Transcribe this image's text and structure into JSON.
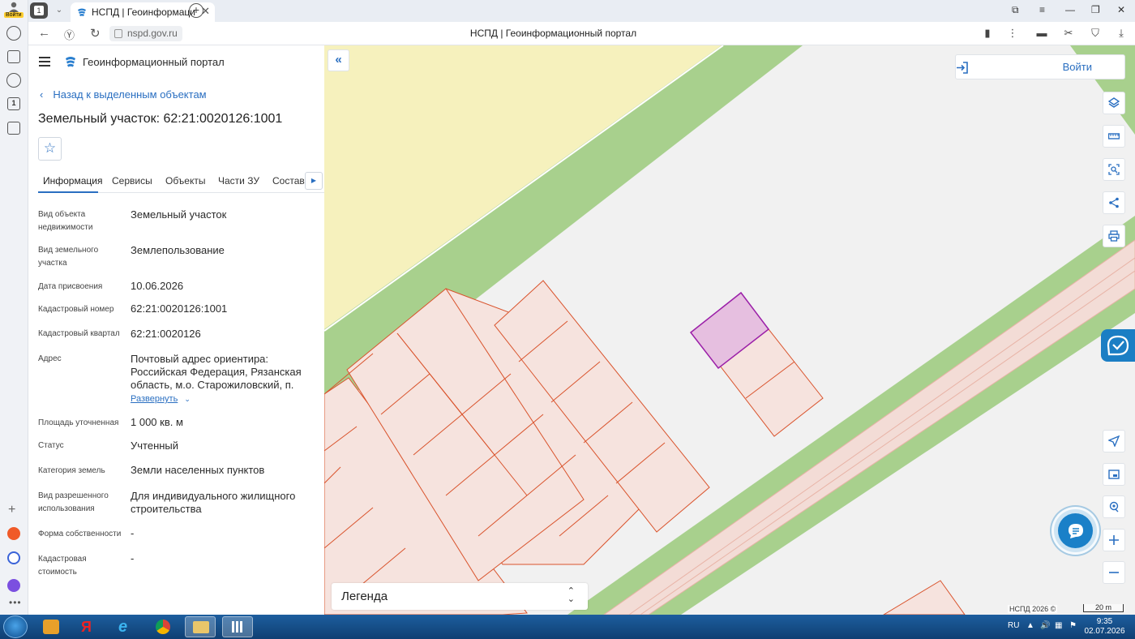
{
  "browser": {
    "account_label": "Войти",
    "tab_counter": "1",
    "tab_title": "НСПД | Геоинформаци",
    "url": "nspd.gov.ru",
    "page_title": "НСПД | Геоинформационный портал"
  },
  "panel": {
    "portal_title": "Геоинформационный портал",
    "back_link": "Назад к выделенным объектам",
    "object_title": "Земельный участок: 62:21:0020126:1001",
    "tabs": [
      "Информация",
      "Сервисы",
      "Объекты",
      "Части ЗУ",
      "Состав"
    ],
    "attributes": [
      {
        "label": "Вид объекта недвижимости",
        "value": "Земельный участок"
      },
      {
        "label": "Вид земельного участка",
        "value": "Землепользование"
      },
      {
        "label": "Дата присвоения",
        "value": "10.06.2026"
      },
      {
        "label": "Кадастровый номер",
        "value": "62:21:0020126:1001"
      },
      {
        "label": "Кадастровый квартал",
        "value": "62:21:0020126"
      },
      {
        "label": "Адрес",
        "value": "Почтовый адрес ориентира: Российская Федерация, Рязанская область, м.о. Старожиловский, п."
      },
      {
        "label": "Площадь уточненная",
        "value": "1 000 кв. м"
      },
      {
        "label": "Статус",
        "value": "Учтенный"
      },
      {
        "label": "Категория земель",
        "value": "Земли населенных пунктов"
      },
      {
        "label": "Вид разрешенного использования",
        "value": "Для индивидуального жилищного строительства"
      },
      {
        "label": "Форма собственности",
        "value": "-"
      },
      {
        "label": "Кадастровая стоимость",
        "value": "-"
      }
    ],
    "expand_label": "Развернуть"
  },
  "map": {
    "login_label": "Войти",
    "legend_label": "Легенда",
    "copyright": "НСПД 2026 ©",
    "scale_label": "20 m"
  },
  "taskbar": {
    "lang": "RU",
    "time": "9:35",
    "date": "02.07.2026"
  },
  "colors": {
    "accent": "#2a6fc1",
    "parcel_fill": "#f6e3de",
    "parcel_stroke": "#d9532c",
    "selected_fill": "#e6bfe0",
    "selected_stroke": "#9b1fa8",
    "green_strip": "#a8d08d",
    "yellow_zone": "#f6f1bd"
  }
}
